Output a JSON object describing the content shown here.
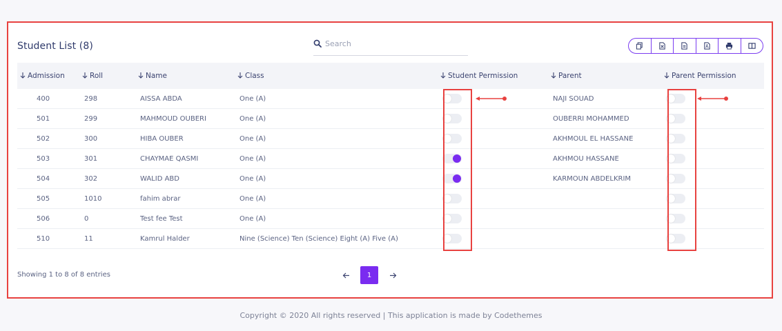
{
  "card": {
    "title": "Student List (8)",
    "search_placeholder": "Search"
  },
  "export_buttons": [
    {
      "icon": "copy-icon"
    },
    {
      "icon": "excel-icon"
    },
    {
      "icon": "csv-icon"
    },
    {
      "icon": "pdf-icon"
    },
    {
      "icon": "print-icon"
    },
    {
      "icon": "columns-icon"
    }
  ],
  "table": {
    "headers": {
      "admission": "Admission",
      "roll": "Roll",
      "name": "Name",
      "class": "Class",
      "student_permission": "Student Permission",
      "parent": "Parent",
      "parent_permission": "Parent Permission"
    },
    "rows": [
      {
        "admission": "400",
        "roll": "298",
        "name": "AISSA ABDA",
        "class": "One (A)",
        "student_permission": false,
        "parent": "NAJI SOUAD",
        "parent_permission": false
      },
      {
        "admission": "501",
        "roll": "299",
        "name": "MAHMOUD OUBERI",
        "class": "One (A)",
        "student_permission": false,
        "parent": "OUBERRI MOHAMMED",
        "parent_permission": false
      },
      {
        "admission": "502",
        "roll": "300",
        "name": "HIBA OUBER",
        "class": "One (A)",
        "student_permission": false,
        "parent": "AKHMOUL EL HASSANE",
        "parent_permission": false
      },
      {
        "admission": "503",
        "roll": "301",
        "name": "CHAYMAE QASMI",
        "class": "One (A)",
        "student_permission": true,
        "parent": "AKHMOU HASSANE",
        "parent_permission": false
      },
      {
        "admission": "504",
        "roll": "302",
        "name": "WALID ABD",
        "class": "One (A)",
        "student_permission": true,
        "parent": "KARMOUN ABDELKRIM",
        "parent_permission": false
      },
      {
        "admission": "505",
        "roll": "1010",
        "name": "fahim abrar",
        "class": "One (A)",
        "student_permission": false,
        "parent": "",
        "parent_permission": false
      },
      {
        "admission": "506",
        "roll": "0",
        "name": "Test fee Test",
        "class": "One (A)",
        "student_permission": false,
        "parent": "",
        "parent_permission": false
      },
      {
        "admission": "510",
        "roll": "11",
        "name": "Kamrul Halder",
        "class": "Nine (Science) Ten (Science) Eight (A) Five (A)",
        "student_permission": false,
        "parent": "",
        "parent_permission": false
      }
    ]
  },
  "pagination": {
    "showing": "Showing 1 to 8 of 8 entries",
    "current_page": "1"
  },
  "footer": {
    "text": "Copyright © 2020 All rights reserved | This application is made by Codethemes"
  },
  "colors": {
    "accent": "#7a2cf0",
    "highlight": "#e8413f"
  }
}
